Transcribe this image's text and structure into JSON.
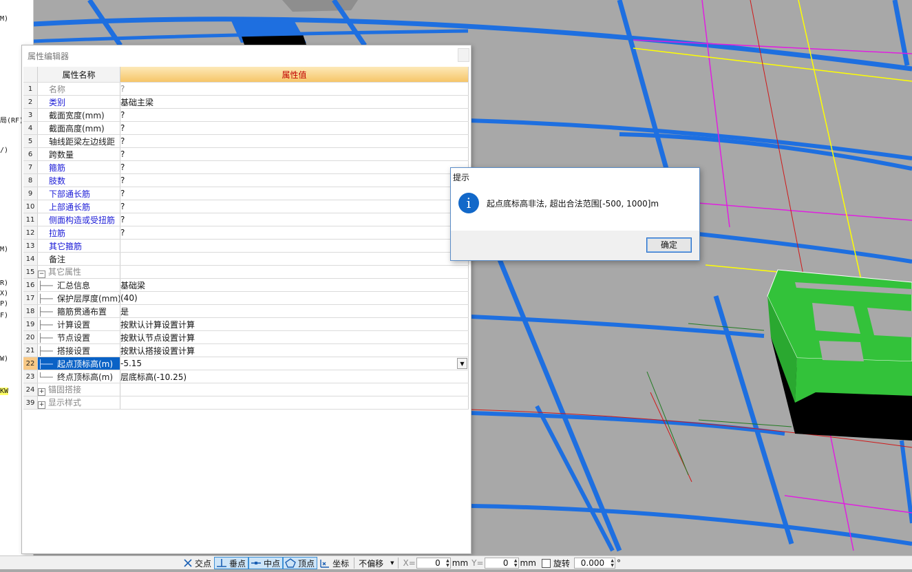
{
  "left_strip": {
    "fragments": [
      "M)",
      "局(RF)",
      "/)",
      "M)",
      "R)",
      "X)",
      "P)",
      "F)",
      "W)",
      "KW"
    ]
  },
  "property_editor": {
    "title": "属性编辑器",
    "header": {
      "name_col": "属性名称",
      "value_col": "属性值"
    },
    "rows": [
      {
        "num": "1",
        "name": "名称",
        "value": "?"
      },
      {
        "num": "2",
        "name": "类别",
        "value": "基础主梁"
      },
      {
        "num": "3",
        "name": "截面宽度(mm)",
        "value": "?"
      },
      {
        "num": "4",
        "name": "截面高度(mm)",
        "value": "?"
      },
      {
        "num": "5",
        "name": "轴线距梁左边线距",
        "value": "?"
      },
      {
        "num": "6",
        "name": "跨数量",
        "value": "?"
      },
      {
        "num": "7",
        "name": "箍筋",
        "value": "?"
      },
      {
        "num": "8",
        "name": "肢数",
        "value": "?"
      },
      {
        "num": "9",
        "name": "下部通长筋",
        "value": "?"
      },
      {
        "num": "10",
        "name": "上部通长筋",
        "value": "?"
      },
      {
        "num": "11",
        "name": "侧面构造或受扭筋",
        "value": "?"
      },
      {
        "num": "12",
        "name": "拉筋",
        "value": "?"
      },
      {
        "num": "13",
        "name": "其它箍筋",
        "value": ""
      },
      {
        "num": "14",
        "name": "备注",
        "value": ""
      },
      {
        "num": "15",
        "name": "其它属性",
        "value": ""
      },
      {
        "num": "16",
        "name": "汇总信息",
        "value": "基础梁"
      },
      {
        "num": "17",
        "name": "保护层厚度(mm)",
        "value": "(40)"
      },
      {
        "num": "18",
        "name": "箍筋贯通布置",
        "value": "是"
      },
      {
        "num": "19",
        "name": "计算设置",
        "value": "按默认计算设置计算"
      },
      {
        "num": "20",
        "name": "节点设置",
        "value": "按默认节点设置计算"
      },
      {
        "num": "21",
        "name": "搭接设置",
        "value": "按默认搭接设置计算"
      },
      {
        "num": "22",
        "name": "起点顶标高(m)",
        "value": "-5.15"
      },
      {
        "num": "23",
        "name": "终点顶标高(m)",
        "value": "层底标高(-10.25)"
      },
      {
        "num": "24",
        "name": "锚固搭接",
        "value": ""
      },
      {
        "num": "39",
        "name": "显示样式",
        "value": ""
      }
    ]
  },
  "dialog": {
    "title": "提示",
    "message": "起点底标高非法, 超出合法范围[-500, 1000]m",
    "ok_label": "确定"
  },
  "status_bar": {
    "snap_intersection": "交点",
    "snap_perpendicular": "垂点",
    "snap_midpoint": "中点",
    "snap_vertex": "顶点",
    "snap_coordinate": "坐标",
    "offset_mode": "不偏移",
    "x_label": "X=",
    "x_value": "0",
    "x_unit": "mm",
    "y_label": "Y=",
    "y_value": "0",
    "y_unit": "mm",
    "rotate_label": "旋转",
    "rotate_value": "0.000",
    "degree_symbol": "°"
  },
  "colors": {
    "beam_blue": "#1e6fe0",
    "slab_green": "#33c23a",
    "axis_magenta": "#e01ee0",
    "axis_yellow": "#ffff00",
    "axis_red": "#d01818",
    "viewport_grey": "#a8a8a8",
    "selected_row": "#0a62c6",
    "link_blue": "#1a1ad6"
  }
}
